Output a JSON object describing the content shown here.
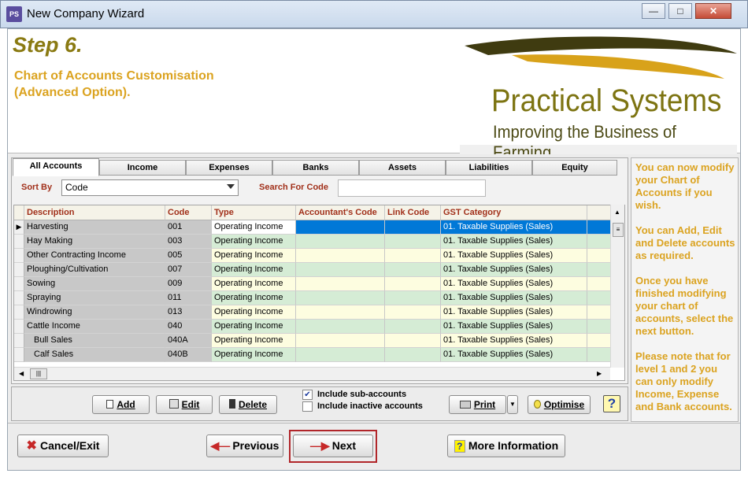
{
  "window": {
    "title": "New Company Wizard",
    "app_icon_text": "PS"
  },
  "header": {
    "step": "Step 6.",
    "subtitle_line1": "Chart of Accounts Customisation",
    "subtitle_line2": "(Advanced Option).",
    "logo_name": "Practical Systems",
    "logo_tagline": "Improving the Business of Farming"
  },
  "tabs": [
    "All Accounts",
    "Income",
    "Expenses",
    "Banks",
    "Assets",
    "Liabilities",
    "Equity"
  ],
  "active_tab": "All Accounts",
  "sort": {
    "label": "Sort By",
    "value": "Code"
  },
  "search": {
    "label": "Search For Code",
    "value": ""
  },
  "grid": {
    "columns": [
      "Description",
      "Code",
      "Type",
      "Accountant's Code",
      "Link Code",
      "GST Category"
    ],
    "rows": [
      {
        "description": "Harvesting",
        "code": "001",
        "type": "Operating Income",
        "acc_code": "",
        "link_code": "",
        "gst": "01. Taxable Supplies (Sales)",
        "selected": true,
        "indent": false
      },
      {
        "description": "Hay Making",
        "code": "003",
        "type": "Operating Income",
        "acc_code": "",
        "link_code": "",
        "gst": "01. Taxable Supplies (Sales)",
        "selected": false,
        "indent": false
      },
      {
        "description": "Other Contracting Income",
        "code": "005",
        "type": "Operating Income",
        "acc_code": "",
        "link_code": "",
        "gst": "01. Taxable Supplies (Sales)",
        "selected": false,
        "indent": false
      },
      {
        "description": "Ploughing/Cultivation",
        "code": "007",
        "type": "Operating Income",
        "acc_code": "",
        "link_code": "",
        "gst": "01. Taxable Supplies (Sales)",
        "selected": false,
        "indent": false
      },
      {
        "description": "Sowing",
        "code": "009",
        "type": "Operating Income",
        "acc_code": "",
        "link_code": "",
        "gst": "01. Taxable Supplies (Sales)",
        "selected": false,
        "indent": false
      },
      {
        "description": "Spraying",
        "code": "011",
        "type": "Operating Income",
        "acc_code": "",
        "link_code": "",
        "gst": "01. Taxable Supplies (Sales)",
        "selected": false,
        "indent": false
      },
      {
        "description": "Windrowing",
        "code": "013",
        "type": "Operating Income",
        "acc_code": "",
        "link_code": "",
        "gst": "01. Taxable Supplies (Sales)",
        "selected": false,
        "indent": false
      },
      {
        "description": "Cattle Income",
        "code": "040",
        "type": "Operating Income",
        "acc_code": "",
        "link_code": "",
        "gst": "01. Taxable Supplies (Sales)",
        "selected": false,
        "indent": false
      },
      {
        "description": "Bull Sales",
        "code": "040A",
        "type": "Operating Income",
        "acc_code": "",
        "link_code": "",
        "gst": "01. Taxable Supplies (Sales)",
        "selected": false,
        "indent": true
      },
      {
        "description": "Calf Sales",
        "code": "040B",
        "type": "Operating Income",
        "acc_code": "",
        "link_code": "",
        "gst": "01. Taxable Supplies (Sales)",
        "selected": false,
        "indent": true
      }
    ]
  },
  "toolbar": {
    "add": "Add",
    "edit": "Edit",
    "delete": "Delete",
    "include_sub": "Include sub-accounts",
    "include_sub_checked": true,
    "include_inactive": "Include inactive accounts",
    "include_inactive_checked": false,
    "print": "Print",
    "optimise": "Optimise",
    "help": "?"
  },
  "help_text": [
    "You can now modify your Chart of Accounts if you wish.",
    "You can Add, Edit and Delete accounts as required.",
    "Once you have finished modifying your chart of accounts, select the next button.",
    "Please note that for level 1 and 2 you can only modify Income, Expense and Bank accounts."
  ],
  "buttons": {
    "cancel": "Cancel/Exit",
    "previous": "Previous",
    "next": "Next",
    "more_info": "More Information"
  },
  "colors": {
    "accent_gold": "#dba320",
    "olive": "#8a7a12",
    "selected_row": "#0078d7",
    "row_green": "#d5ecd5",
    "row_yellow": "#fdfde0"
  }
}
